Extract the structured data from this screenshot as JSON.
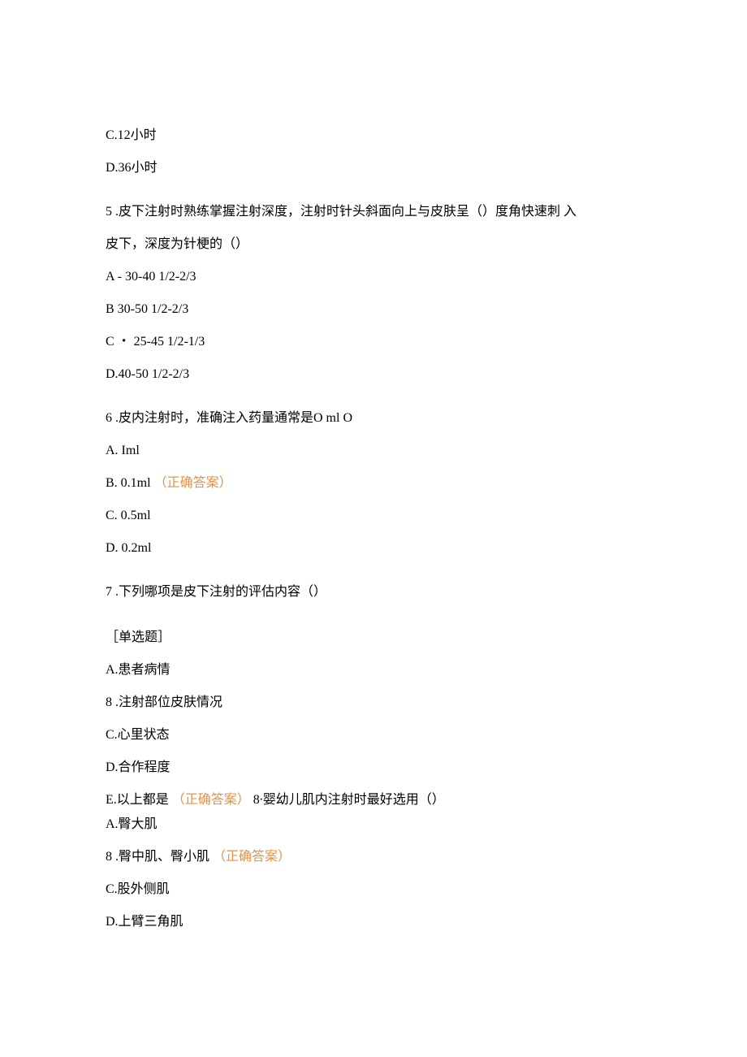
{
  "d": {
    "q4_c": "C.12小时",
    "q4_d": "D.36小时",
    "q5": "5 .皮下注射时熟练掌握注射深度，注射时针头斜面向上与皮肤呈（）度角快速刺 入",
    "q5_cont": "皮下，深度为针梗的（）",
    "q5_a": "A - 30-40 1/2-2/3",
    "q5_b": "B 30-50 1/2-2/3",
    "q5_c": "C ・ 25-45 1/2-1/3",
    "q5_d": "D.40-50 1/2-2/3",
    "q6": "6 .皮内注射时，准确注入药量通常是O ml O",
    "q6_a": "A.  Iml",
    "q6_b_pre": "B.  0.1ml",
    "q6_b_ans": "（正确答案）",
    "q6_c": "C.  0.5ml",
    "q6_d": "D.  0.2ml",
    "q7": "7 .下列哪项是皮下注射的评估内容（）",
    "q7_type": "［单选题］",
    "q7_a": "A.患者病情",
    "q7_8a": "8 .注射部位皮肤情况",
    "q7_c": "C.心里状态",
    "q7_d": "D.合作程度",
    "q7_e_pre": "E.以上都是",
    "q7_e_ans": "（正确答案）",
    "q7_e_post": " 8∙婴幼儿肌内注射时最好选用（）",
    "q8_a": "A.臀大肌",
    "q8_b_pre": "8 .臀中肌、臀小肌",
    "q8_b_ans": "（正确答案）",
    "q8_c": "C.股外侧肌",
    "q8_d": "D.上臂三角肌"
  }
}
